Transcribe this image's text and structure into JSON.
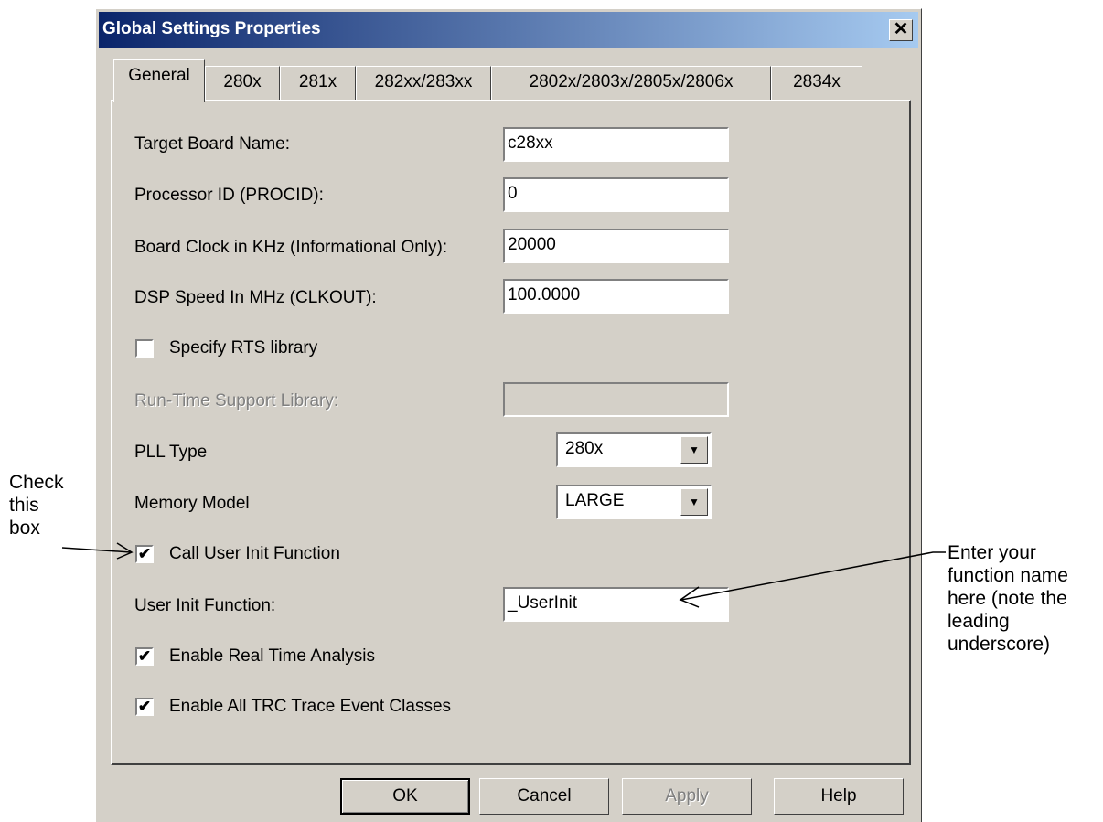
{
  "dialog": {
    "title": "Global Settings Properties",
    "close_glyph": "✕"
  },
  "tabs": [
    {
      "label": "General",
      "active": true
    },
    {
      "label": "280x"
    },
    {
      "label": "281x"
    },
    {
      "label": "282xx/283xx"
    },
    {
      "label": "2802x/2803x/2805x/2806x"
    },
    {
      "label": "2834x"
    }
  ],
  "fields": {
    "target_board_name": {
      "label": "Target Board Name:",
      "value": "c28xx"
    },
    "processor_id": {
      "label": "Processor ID (PROCID):",
      "value": "0"
    },
    "board_clock": {
      "label": "Board Clock in KHz (Informational Only):",
      "value": "20000"
    },
    "dsp_speed": {
      "label": "DSP Speed In MHz (CLKOUT):",
      "value": "100.0000"
    },
    "specify_rts": {
      "label": "Specify RTS library",
      "checked": false
    },
    "rts_library": {
      "label": "Run-Time Support Library:",
      "value": "",
      "disabled": true
    },
    "pll_type": {
      "label": "PLL Type",
      "value": "280x"
    },
    "memory_model": {
      "label": "Memory Model",
      "value": "LARGE"
    },
    "call_user_init": {
      "label": "Call User Init Function",
      "checked": true
    },
    "user_init_function": {
      "label": "User Init Function:",
      "value": "_UserInit"
    },
    "enable_rta": {
      "label": "Enable Real Time Analysis",
      "checked": true
    },
    "enable_trc": {
      "label": "Enable All TRC Trace Event Classes",
      "checked": true
    }
  },
  "check_glyph": "✔",
  "dropdown_glyph": "▼",
  "buttons": {
    "ok": "OK",
    "cancel": "Cancel",
    "apply": "Apply",
    "help": "Help"
  },
  "annotations": {
    "left_line1": "Check",
    "left_line2": "this",
    "left_line3": "box",
    "right_line1": "Enter your",
    "right_line2": "function name",
    "right_line3": "here (note the",
    "right_line4": "leading",
    "right_line5": "underscore)"
  }
}
